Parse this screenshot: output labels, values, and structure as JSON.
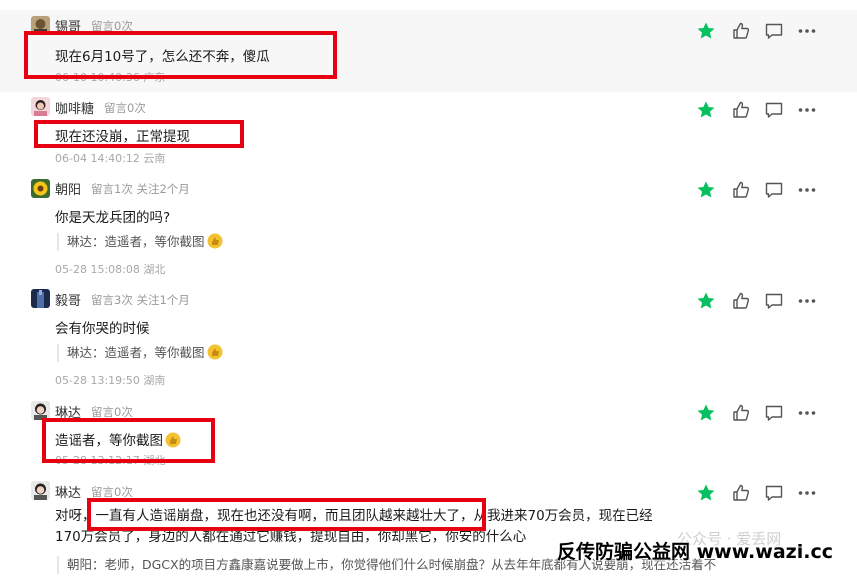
{
  "colors": {
    "star": "#07c160",
    "red_box": "#e60012",
    "meta": "#9a9a9a"
  },
  "icons": {
    "star": "star-icon",
    "like": "thumbs-up-icon",
    "reply": "comment-icon",
    "more": "more-icon"
  },
  "comments": [
    {
      "nickname": "锡哥",
      "meta": "留言0次",
      "content": "现在6月10号了，怎么还不奔，傻瓜",
      "time": "06-10 10:40:36 广东",
      "reply": ""
    },
    {
      "nickname": "咖啡糖",
      "meta": "留言0次",
      "content": "现在还没崩，正常提现",
      "time": "06-04 14:40:12 云南",
      "reply": ""
    },
    {
      "nickname": "朝阳",
      "meta": "留言1次 关注2个月",
      "content": "你是天龙兵团的吗?",
      "time": "05-28 15:08:08 湖北",
      "reply": "琳达：造遥者，等你截图"
    },
    {
      "nickname": "毅哥",
      "meta": "留言3次 关注1个月",
      "content": "会有你哭的时候",
      "time": "05-28 13:19:50 湖南",
      "reply": "琳达：造遥者，等你截图"
    },
    {
      "nickname": "琳达",
      "meta": "留言0次",
      "content": "造谣者，等你截图",
      "time": "05-28 13:12:17 湖北",
      "reply": ""
    },
    {
      "nickname": "琳达",
      "meta": "留言0次",
      "content_line1_prefix": "对呀，",
      "content_line1_boxed": "一直有人造谣崩盘，现在也还没有啊，而且团队越来越壮大了，",
      "content_line1_suffix": "从我进来70万会员，现在已经",
      "content_line2": "170万会员了，身边的人都在通过它赚钱，提现自由，你却黑它，你安的什么心",
      "reply": "朝阳：老师，DGCX的项目方鑫康嘉说要做上市，你觉得他们什么时候崩盘？从去年年底都有人说要崩，现在还活着不"
    }
  ],
  "watermark": "公众号 · 爱丢网",
  "banner": "反传防骗公益网 www.wazi.cc"
}
